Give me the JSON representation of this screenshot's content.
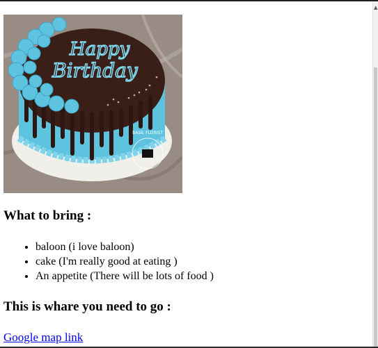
{
  "image": {
    "alt": "Happy Birthday cake",
    "cake_text_line1": "Happy",
    "cake_text_line2": "Birthday",
    "watermark_text": "BASIL FLORIST",
    "colors": {
      "frosting": "#5ec3df",
      "chocolate": "#3a1f18",
      "board": "#f2f2ee",
      "background": "#9a8f86"
    }
  },
  "sections": {
    "bring_heading": "What to bring :",
    "items": [
      "baloon (i love baloon)",
      "cake (I'm really good at eating )",
      "An appetite (There will be lots of food )"
    ],
    "go_heading": "This is whare you need to go :",
    "map_link": "Google map link"
  },
  "colors": {
    "link": "#0000ee",
    "text": "#000000"
  }
}
